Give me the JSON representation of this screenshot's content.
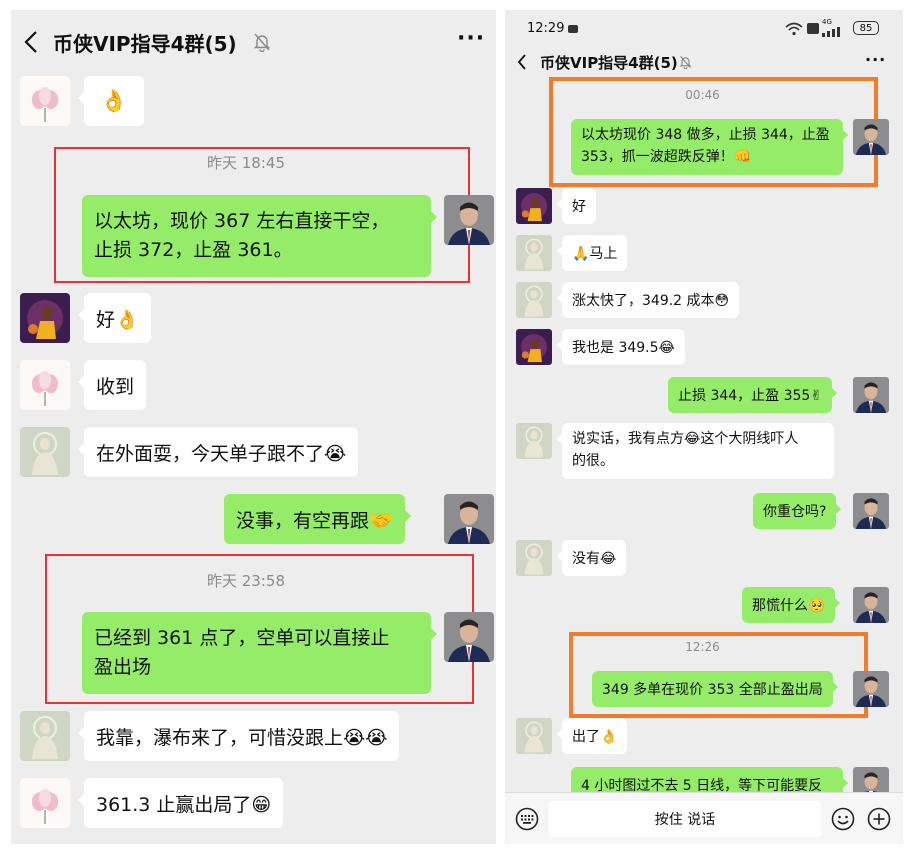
{
  "left_screen": {
    "title": "币侠VIP指导4群(5)",
    "more_label": "···",
    "emoji_ok": "👌",
    "timestamp_1": "昨天 18:45",
    "msg_short_line1": "以太坊，现价 367 左右直接干空，",
    "msg_short_line2": "止损 372，止盈 361。",
    "reply_hao": "好👌",
    "reply_shoudao": "收到",
    "reply_waimian": "在外面耍，今天单子跟不了😭",
    "msg_meishi": "没事，有空再跟🤝",
    "timestamp_2": "昨天 23:58",
    "msg_tp_line1": "已经到 361 点了，空单可以直接止",
    "msg_tp_line2": "盈出场",
    "reply_pubu": "我靠，瀑布来了，可惜没跟上😭😭",
    "reply_zhiying": "361.3 止赢出局了😁"
  },
  "right_screen": {
    "status": {
      "time": "12:29",
      "battery": "85",
      "network": "4G"
    },
    "title": "币侠VIP指导4群(5)",
    "more_label": "···",
    "timestamp_1": "00:46",
    "msg_long_line1": "以太坊现价 348 做多，止损 344，止盈",
    "msg_long_line2": "353，抓一波超跌反弹！👊",
    "reply_hao": "好",
    "reply_mashang": "🙏马上",
    "reply_zhangtai": "涨太快了，349.2 成本😳",
    "reply_woye": "我也是 349.5😂",
    "msg_sl": "止损 344，止盈 355✌",
    "reply_shuoshihua_line1": "说实话，我有点方😂这个大阴线吓人",
    "reply_shuoshihua_line2": "的很。",
    "msg_zhongcang": "你重仓吗?",
    "reply_meiyou": "没有😂",
    "msg_nahuang": "那慌什么🥺",
    "timestamp_2": "12:26",
    "msg_close": "349 多单在现价 353 全部止盈出局",
    "reply_chule": "出了👌",
    "msg_partial": "4 小时图过不去 5 日线，等下可能要反",
    "hold_talk": "按住 说话"
  },
  "colors": {
    "chat_bg": "#ededed",
    "sent_bubble": "#95ec69",
    "received_bubble": "#ffffff",
    "red_highlight": "#e2343a",
    "orange_highlight": "#f07c2c",
    "timestamp_text": "#8b8b8b"
  }
}
